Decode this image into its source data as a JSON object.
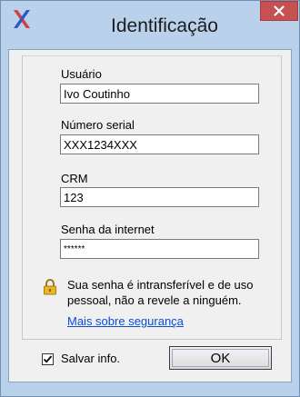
{
  "window": {
    "title": "Identificação",
    "close_symbol": "×"
  },
  "fields": [
    {
      "label": "Usuário",
      "value": "Ivo Coutinho"
    },
    {
      "label": "Número serial",
      "value": "XXX1234XXX"
    },
    {
      "label": "CRM",
      "value": "123"
    },
    {
      "label": "Senha da internet",
      "value": "******"
    }
  ],
  "notice": {
    "line1": "Sua senha é intransferível e de uso",
    "line2": "pessoal, não a revele a ninguém."
  },
  "link": {
    "label": "Mais sobre segurança"
  },
  "save_info": {
    "label": "Salvar info.",
    "checked": true
  },
  "ok_button": {
    "label": "OK"
  },
  "icons": {
    "app": "app-logo-icon",
    "close": "close-icon",
    "lock": "lock-icon",
    "checkmark": "checkmark-icon"
  },
  "colors": {
    "window_frame": "#b9d1ea",
    "close_button": "#c75050",
    "link": "#0a4ed8"
  }
}
